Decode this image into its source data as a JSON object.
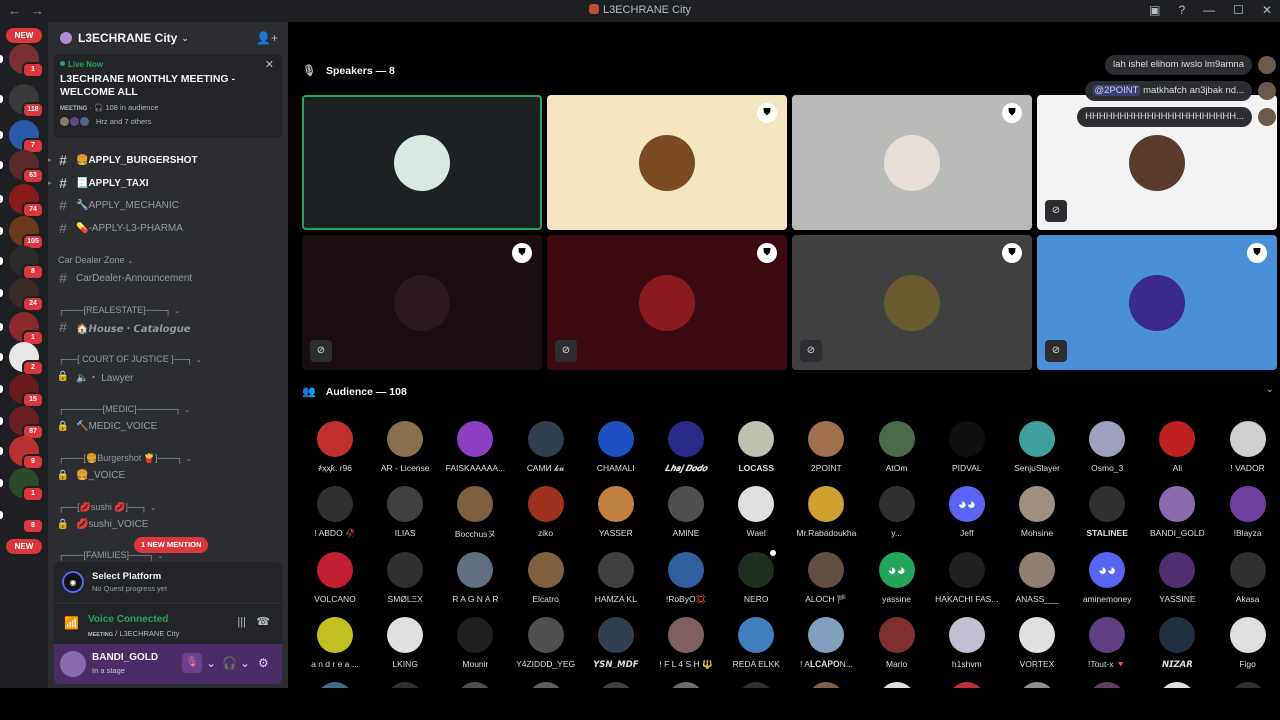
{
  "window": {
    "title": "L3ECHRANE City",
    "controls": [
      "minimize",
      "maximize",
      "close"
    ]
  },
  "rail": {
    "new_label": "NEW",
    "servers": [
      {
        "color": "#7a3030",
        "badge": "1"
      },
      {
        "color": "#3a3a3a",
        "badge": "118"
      },
      {
        "color": "#2b5aa8",
        "badge": "7"
      },
      {
        "color": "#5a2a2a",
        "badge": "63"
      },
      {
        "color": "#8a1a1a",
        "badge": "74"
      },
      {
        "color": "#6a3a1a",
        "badge": "105"
      },
      {
        "color": "#2a2a2a",
        "badge": "8"
      },
      {
        "color": "#3a2a2a",
        "badge": "24"
      },
      {
        "color": "#8a2a2a",
        "badge": "1"
      },
      {
        "color": "#e8e8e8",
        "badge": "2"
      },
      {
        "color": "#6a1a1a",
        "badge": "15"
      },
      {
        "color": "#6a2020",
        "badge": "87"
      },
      {
        "color": "#b83030",
        "badge": "9"
      },
      {
        "color": "#2a4a2a",
        "badge": "1"
      },
      {
        "color": "#202020",
        "badge": "8"
      }
    ],
    "new_bottom_label": "NEW"
  },
  "guild": {
    "name": "L3ECHRANE City"
  },
  "live_card": {
    "status": "Live Now",
    "title": "L3ECHRANE MONTHLY MEETING - WELCOME ALL",
    "tag": "MEETING",
    "audience": "108 in audience",
    "others": "Hrz and 7 others"
  },
  "channels": [
    {
      "name": "🍔APPLY_BURGERSHOT",
      "type": "text",
      "unread": true
    },
    {
      "name": "📃APPLY_TAXI",
      "type": "text",
      "unread": true
    },
    {
      "name": "🔧APPLY_MECHANIC",
      "type": "text",
      "unread": false
    },
    {
      "name": "💊-APPLY-L3-PHARMA",
      "type": "text",
      "unread": false
    },
    {
      "name": "Car Dealer Zone",
      "type": "category"
    },
    {
      "name": "CarDealer-Announcement",
      "type": "text",
      "unread": false
    },
    {
      "name": "┌───[REALESTATE]───┐",
      "type": "category"
    },
    {
      "name": "🏠𝙃𝙤𝙪𝙨𝙚・𝘾𝙖𝙩𝙖𝙡𝙤𝙜𝙪𝙚",
      "type": "text",
      "unread": false
    },
    {
      "name": "┌──[ COURT OF JUSTICE ]──┐",
      "type": "category"
    },
    {
      "name": "🔈・ Lawyer",
      "type": "voice",
      "unread": false
    },
    {
      "name": "┌──────[MEDIC]──────┐",
      "type": "category"
    },
    {
      "name": "🔨MEDIC_VOICE",
      "type": "voice",
      "unread": false
    },
    {
      "name": "┌───[🍔Burgershot 🍟]───┐",
      "type": "category"
    },
    {
      "name": "🍔_VOICE",
      "type": "voice",
      "unread": false
    },
    {
      "name": "┌──[💋sushi 💋]──┐",
      "type": "category"
    },
    {
      "name": "💋sushi_VOICE",
      "type": "voice",
      "unread": false
    },
    {
      "name": "┌───[FAMILIES]───┐",
      "type": "category"
    }
  ],
  "mention_pill": "1 NEW MENTION",
  "platform": {
    "title": "Select Platform",
    "subtitle": "No Quest progress yet"
  },
  "voice": {
    "status": "Voice Connected",
    "tag": "MEETING",
    "channel": "L3ECHRANE City"
  },
  "user": {
    "name": "BANDI_GOLD",
    "status": "In a stage"
  },
  "speakers": {
    "label": "Speakers — 8",
    "tiles": [
      {
        "bg": "#1e2124",
        "avatar": "#d9e8e0",
        "moderator": false,
        "muted": false,
        "speaking": true
      },
      {
        "bg": "#f3e6c0",
        "avatar": "#7a4a20",
        "moderator": true,
        "muted": false,
        "speaking": false
      },
      {
        "bg": "#b9bbb8",
        "avatar": "#e8e0d8",
        "moderator": true,
        "muted": false,
        "speaking": false
      },
      {
        "bg": "#f2f2f2",
        "avatar": "#5a3a2a",
        "moderator": false,
        "muted": true,
        "speaking": false
      },
      {
        "bg": "#1a0d0f",
        "avatar": "#2a1a20",
        "moderator": true,
        "muted": true,
        "speaking": false
      },
      {
        "bg": "#3a0a10",
        "avatar": "#8a1a20",
        "moderator": true,
        "muted": true,
        "speaking": false
      },
      {
        "bg": "#404040",
        "avatar": "#6a5a30",
        "moderator": true,
        "muted": true,
        "speaking": false
      },
      {
        "bg": "#4a90d8",
        "avatar": "#3a2a90",
        "moderator": true,
        "muted": true,
        "speaking": false
      }
    ]
  },
  "chat": [
    {
      "text": "lah ishel elihom iwslo lm9amna",
      "mention": ""
    },
    {
      "text": " matkhafch an3jbak nd...",
      "mention": "@2POINT"
    },
    {
      "text": "HHHHHHHHHHHHHHHHHHHHHH...",
      "mention": ""
    }
  ],
  "audience": {
    "label": "Audience — 108",
    "members": [
      {
        "name": "҂ҳҳƙ. r96",
        "color": "#c03030",
        "style": ""
      },
      {
        "name": "AR - License",
        "color": "#8a7050",
        "style": ""
      },
      {
        "name": "FAISKAAAAA...",
        "color": "#8a40c0",
        "style": ""
      },
      {
        "name": "САМИ 𝓴𝓾",
        "color": "#304050",
        "style": ""
      },
      {
        "name": "CHAMALI",
        "color": "#2050c0",
        "style": ""
      },
      {
        "name": "𝑳𝒉𝒂𝒋 𝑫𝒐𝒅𝒐",
        "color": "#2a2a8a",
        "style": "italic"
      },
      {
        "name": "LOCASS",
        "color": "#c0c0b0",
        "style": "bold"
      },
      {
        "name": "2POINT",
        "color": "#a07050",
        "style": ""
      },
      {
        "name": "AtOm",
        "color": "#4a6a4a",
        "style": ""
      },
      {
        "name": "PIDVAL",
        "color": "#101010",
        "style": ""
      },
      {
        "name": "SenjuSlayer",
        "color": "#40a0a0",
        "style": ""
      },
      {
        "name": "Osmo_3",
        "color": "#a0a0c0",
        "style": ""
      },
      {
        "name": "Ali",
        "color": "#c02020",
        "style": ""
      },
      {
        "name": "! VADOR",
        "color": "#d0d0d0",
        "style": ""
      },
      {
        "name": "! ABDO 🥀",
        "color": "#303030",
        "style": ""
      },
      {
        "name": "ILIAS",
        "color": "#404040",
        "style": ""
      },
      {
        "name": "Bocchusヌ",
        "color": "#806040",
        "style": ""
      },
      {
        "name": "ziko",
        "color": "#a03020",
        "style": ""
      },
      {
        "name": "YASSER",
        "color": "#c08040",
        "style": ""
      },
      {
        "name": "AMINE",
        "color": "#505050",
        "style": ""
      },
      {
        "name": "Wael",
        "color": "#e0e0e0",
        "style": ""
      },
      {
        "name": "Mr.Rabadoukha",
        "color": "#d0a030",
        "style": ""
      },
      {
        "name": "y...",
        "color": "#303030",
        "style": ""
      },
      {
        "name": "Jeff",
        "color": "#5865f2",
        "style": "discord"
      },
      {
        "name": "Mohsine",
        "color": "#a09080",
        "style": ""
      },
      {
        "name": "STALINEE",
        "color": "#303030",
        "style": "bold"
      },
      {
        "name": "BANDI_GOLD",
        "color": "#8a6bb0",
        "style": ""
      },
      {
        "name": "!Blayza",
        "color": "#7040a0",
        "style": ""
      },
      {
        "name": "VOLCANO",
        "color": "#c02030",
        "style": ""
      },
      {
        "name": "SMØLΞX",
        "color": "#303030",
        "style": ""
      },
      {
        "name": "R A G N A R",
        "color": "#607080",
        "style": ""
      },
      {
        "name": "Elcatro",
        "color": "#806040",
        "style": ""
      },
      {
        "name": "HAMZA KL",
        "color": "#404040",
        "style": ""
      },
      {
        "name": "!RoByO💢",
        "color": "#3060a0",
        "style": ""
      },
      {
        "name": "NERO",
        "color": "#203020",
        "style": ""
      },
      {
        "name": "ALOCH 🏴",
        "color": "#605040",
        "style": ""
      },
      {
        "name": "yassine",
        "color": "#23a55a",
        "style": "discord"
      },
      {
        "name": "HAKACHI FAS...",
        "color": "#202020",
        "style": ""
      },
      {
        "name": "ANASS___",
        "color": "#908070",
        "style": ""
      },
      {
        "name": "aminemoney",
        "color": "#5865f2",
        "style": "discord"
      },
      {
        "name": "YASSINE",
        "color": "#503070",
        "style": ""
      },
      {
        "name": "Akasa",
        "color": "#303030",
        "style": ""
      },
      {
        "name": "a n d r e a ...",
        "color": "#c0c020",
        "style": ""
      },
      {
        "name": "LKING",
        "color": "#e0e0e0",
        "style": ""
      },
      {
        "name": "Mounir",
        "color": "#202020",
        "style": ""
      },
      {
        "name": "Y4ZIDDD_YEG",
        "color": "#505050",
        "style": ""
      },
      {
        "name": "𝙔𝙎𝙉_𝙈𝘿𝙁",
        "color": "#304050",
        "style": "italic"
      },
      {
        "name": "! F L 4 S H 🔱",
        "color": "#806060",
        "style": ""
      },
      {
        "name": "REDA ELKK",
        "color": "#4080c0",
        "style": ""
      },
      {
        "name": "! A𝐋𝐂𝐀𝐏𝐎N...",
        "color": "#80a0c0",
        "style": ""
      },
      {
        "name": "Mario",
        "color": "#803030",
        "style": ""
      },
      {
        "name": "h1shvm",
        "color": "#c0c0d0",
        "style": ""
      },
      {
        "name": "VORTEX",
        "color": "#e0e0e0",
        "style": ""
      },
      {
        "name": "!Tout-x 🔻",
        "color": "#604080",
        "style": ""
      },
      {
        "name": "𝙉𝙄𝙕𝘼𝙍",
        "color": "#203040",
        "style": "italic"
      },
      {
        "name": "Figo",
        "color": "#e0e0e0",
        "style": ""
      }
    ]
  }
}
